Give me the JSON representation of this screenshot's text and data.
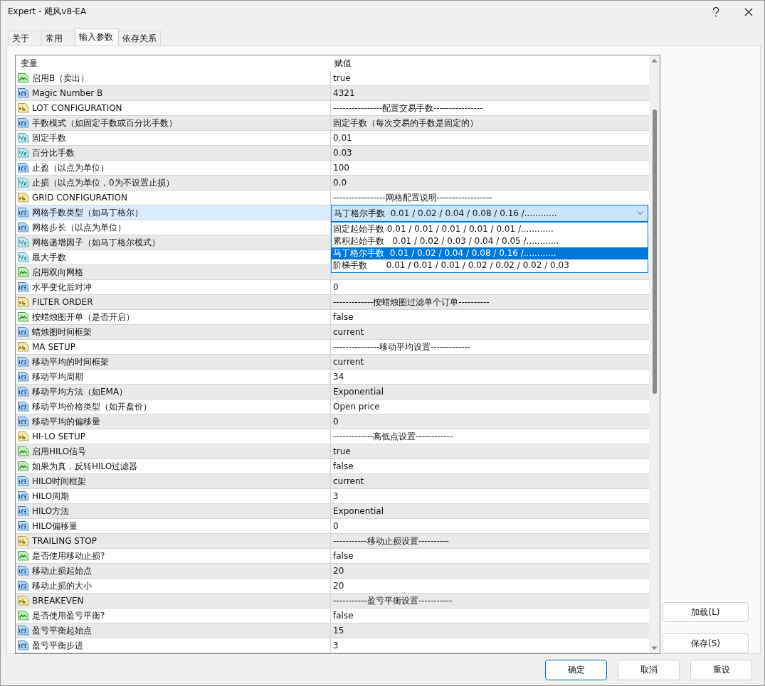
{
  "window": {
    "title": "Expert - 飓风v8-EA"
  },
  "tabs": [
    {
      "label": "关于",
      "selected": false
    },
    {
      "label": "常用",
      "selected": false
    },
    {
      "label": "输入参数",
      "selected": true
    },
    {
      "label": "依存关系",
      "selected": false
    }
  ],
  "table": {
    "columns": [
      "变量",
      "赋值"
    ],
    "rows": [
      {
        "kind": "bool",
        "name": "启用B（卖出）",
        "value": "true",
        "selected": false
      },
      {
        "kind": "int",
        "name": "Magic Number  B",
        "value": "4321",
        "selected": false
      },
      {
        "kind": "string",
        "name": "LOT CONFIGURATION",
        "value": "----------------配置交易手数----------------",
        "selected": false
      },
      {
        "kind": "int",
        "name": "手数模式（如固定手数或百分比手数）",
        "value": "固定手数（每次交易的手数是固定的）",
        "selected": false
      },
      {
        "kind": "double",
        "name": "固定手数",
        "value": "0.01",
        "selected": false
      },
      {
        "kind": "double",
        "name": "百分比手数",
        "value": "0.03",
        "selected": false
      },
      {
        "kind": "int",
        "name": "止盈（以点为单位）",
        "value": "100",
        "selected": false
      },
      {
        "kind": "double",
        "name": "止损（以点为单位，0为不设置止损）",
        "value": "0.0",
        "selected": false
      },
      {
        "kind": "string",
        "name": "GRID CONFIGURATION",
        "value": "-----------------网格配置说明------------------",
        "selected": false
      },
      {
        "kind": "int",
        "name": "网格手数类型（如马丁格尔）",
        "value": "马丁格尔手数  0.01 / 0.02 / 0.04 / 0.08 / 0.16 /............",
        "selected": true,
        "dropdown": [
          {
            "label": "固定起始手数 0.01 / 0.01 / 0.01 / 0.01 / 0.01 /............",
            "selected": false
          },
          {
            "label": "累积起始手数   0.01 / 0.02 / 0.03 / 0.04 / 0.05 /............",
            "selected": false
          },
          {
            "label": "马丁格尔手数  0.01 / 0.02 / 0.04 / 0.08 / 0.16 /............",
            "selected": true
          },
          {
            "label": "阶梯手数       0.01 / 0.01 / 0.01 / 0.02 / 0.02 / 0.02 / 0.03",
            "selected": false
          }
        ]
      },
      {
        "kind": "int",
        "name": "网格步长（以点为单位）",
        "selected": false
      },
      {
        "kind": "double",
        "name": "网格递增因子（如马丁格尔模式）",
        "selected": false
      },
      {
        "kind": "double",
        "name": "最大手数",
        "selected": false
      },
      {
        "kind": "bool",
        "name": "启用双向网格",
        "selected": false
      },
      {
        "kind": "int",
        "name": "水平变化后对冲",
        "value": "0",
        "selected": false
      },
      {
        "kind": "string",
        "name": "FILTER ORDER",
        "value": "-------------按蜡烛图过滤单个订单----------",
        "selected": false
      },
      {
        "kind": "bool",
        "name": "按蜡烛图开单（是否开启）",
        "value": "false",
        "selected": false
      },
      {
        "kind": "int",
        "name": "蜡烛图时间框架",
        "value": "current",
        "selected": false
      },
      {
        "kind": "string",
        "name": "MA SETUP",
        "value": "---------------移动平均设置-------------",
        "selected": false
      },
      {
        "kind": "int",
        "name": "移动平均的时间框架",
        "value": "current",
        "selected": false
      },
      {
        "kind": "int",
        "name": "移动平均周期",
        "value": "34",
        "selected": false
      },
      {
        "kind": "int",
        "name": "移动平均方法（如EMA）",
        "value": "Exponential",
        "selected": false
      },
      {
        "kind": "int",
        "name": "移动平均价格类型（如开盘价）",
        "value": "Open price",
        "selected": false
      },
      {
        "kind": "int",
        "name": "移动平均的偏移量",
        "value": "0",
        "selected": false
      },
      {
        "kind": "string",
        "name": "HI-LO SETUP",
        "value": "-------------高低点设置------------",
        "selected": false
      },
      {
        "kind": "bool",
        "name": "启用HILO信号",
        "value": "true",
        "selected": false
      },
      {
        "kind": "bool",
        "name": "如果为真，反转HILO过滤器",
        "value": "false",
        "selected": false
      },
      {
        "kind": "int",
        "name": "HILO时间框架",
        "value": "current",
        "selected": false
      },
      {
        "kind": "int",
        "name": "HILO周期",
        "value": "3",
        "selected": false
      },
      {
        "kind": "int",
        "name": "HILO方法",
        "value": "Exponential",
        "selected": false
      },
      {
        "kind": "int",
        "name": "HILO偏移量",
        "value": "0",
        "selected": false
      },
      {
        "kind": "string",
        "name": "TRAILING STOP",
        "value": "-----------移动止损设置----------",
        "selected": false
      },
      {
        "kind": "bool",
        "name": "是否使用移动止损?",
        "value": "false",
        "selected": false
      },
      {
        "kind": "int",
        "name": "移动止损起始点",
        "value": "20",
        "selected": false
      },
      {
        "kind": "int",
        "name": "移动止损的大小",
        "value": "20",
        "selected": false
      },
      {
        "kind": "string",
        "name": "BREAKEVEN",
        "value": "-----------盈亏平衡设置-----------",
        "selected": false
      },
      {
        "kind": "bool",
        "name": "是否使用盈亏平衡?",
        "value": "false",
        "selected": false
      },
      {
        "kind": "int",
        "name": "盈亏平衡起始点",
        "value": "15",
        "selected": false
      },
      {
        "kind": "int",
        "name": "盈亏平衡步进",
        "value": "3",
        "selected": false
      }
    ]
  },
  "side_buttons": [
    "加载(L)",
    "保存(S)"
  ],
  "buttons": [
    {
      "label": "确定",
      "default": true
    },
    {
      "label": "取消",
      "default": false
    },
    {
      "label": "重设",
      "default": false
    }
  ]
}
